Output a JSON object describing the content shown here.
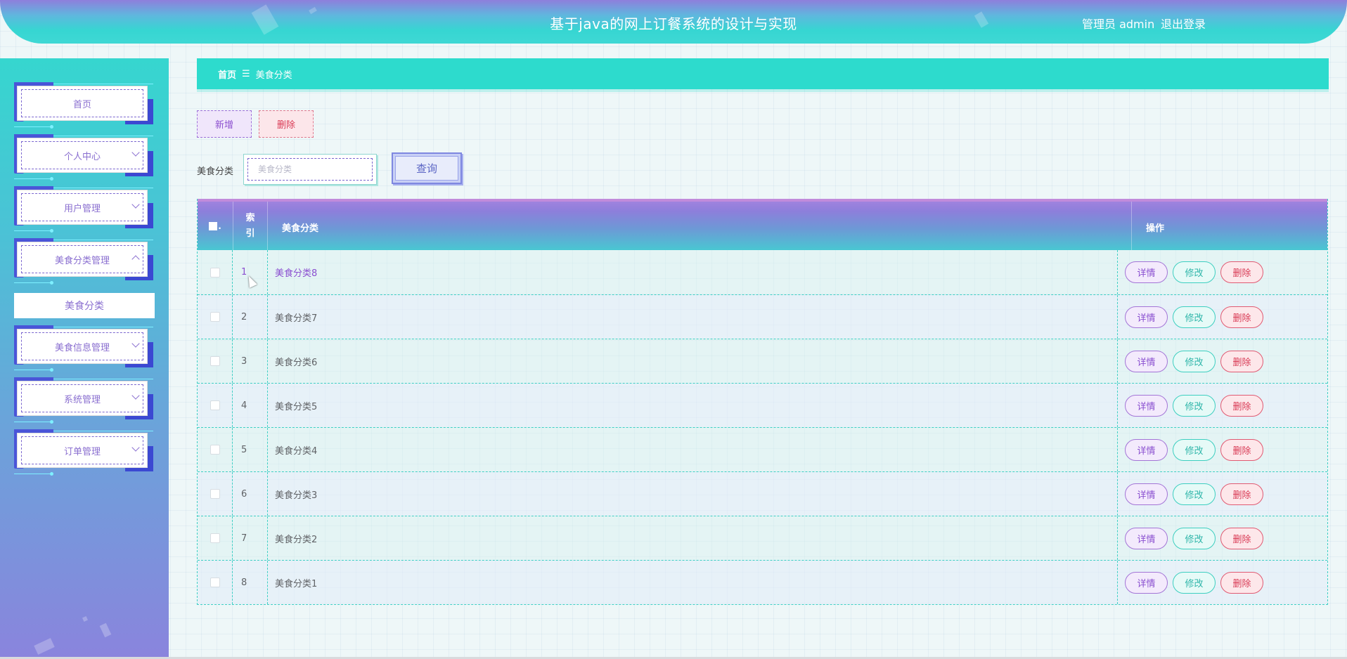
{
  "header": {
    "title": "基于java的网上订餐系统的设计与实现",
    "user": "管理员 admin",
    "logout": "退出登录"
  },
  "sidebar": {
    "items": [
      {
        "label": "首页",
        "has_arrow": false
      },
      {
        "label": "个人中心",
        "has_arrow": true
      },
      {
        "label": "用户管理",
        "has_arrow": true
      },
      {
        "label": "美食分类管理",
        "has_arrow": true,
        "expanded": true
      },
      {
        "label": "美食信息管理",
        "has_arrow": true
      },
      {
        "label": "系统管理",
        "has_arrow": true
      },
      {
        "label": "订单管理",
        "has_arrow": true
      }
    ],
    "submenu_label": "美食分类"
  },
  "breadcrumb": {
    "home": "首页",
    "separator": "☰",
    "current": "美食分类"
  },
  "toolbar": {
    "add_label": "新增",
    "delete_label": "删除"
  },
  "search": {
    "label": "美食分类",
    "placeholder": "美食分类",
    "value": "",
    "button_label": "查询"
  },
  "table": {
    "headers": {
      "index": "索引",
      "name": "美食分类",
      "ops": "操作"
    },
    "rows": [
      {
        "index": "1",
        "name": "美食分类8"
      },
      {
        "index": "2",
        "name": "美食分类7"
      },
      {
        "index": "3",
        "name": "美食分类6"
      },
      {
        "index": "4",
        "name": "美食分类5"
      },
      {
        "index": "5",
        "name": "美食分类4"
      },
      {
        "index": "6",
        "name": "美食分类3"
      },
      {
        "index": "7",
        "name": "美食分类2"
      },
      {
        "index": "8",
        "name": "美食分类1"
      }
    ],
    "actions": {
      "detail": "详情",
      "edit": "修改",
      "delete": "删除"
    }
  },
  "colors": {
    "accent": "#2ddbcd",
    "purple": "#8a4fd0",
    "danger": "#d93a55"
  }
}
